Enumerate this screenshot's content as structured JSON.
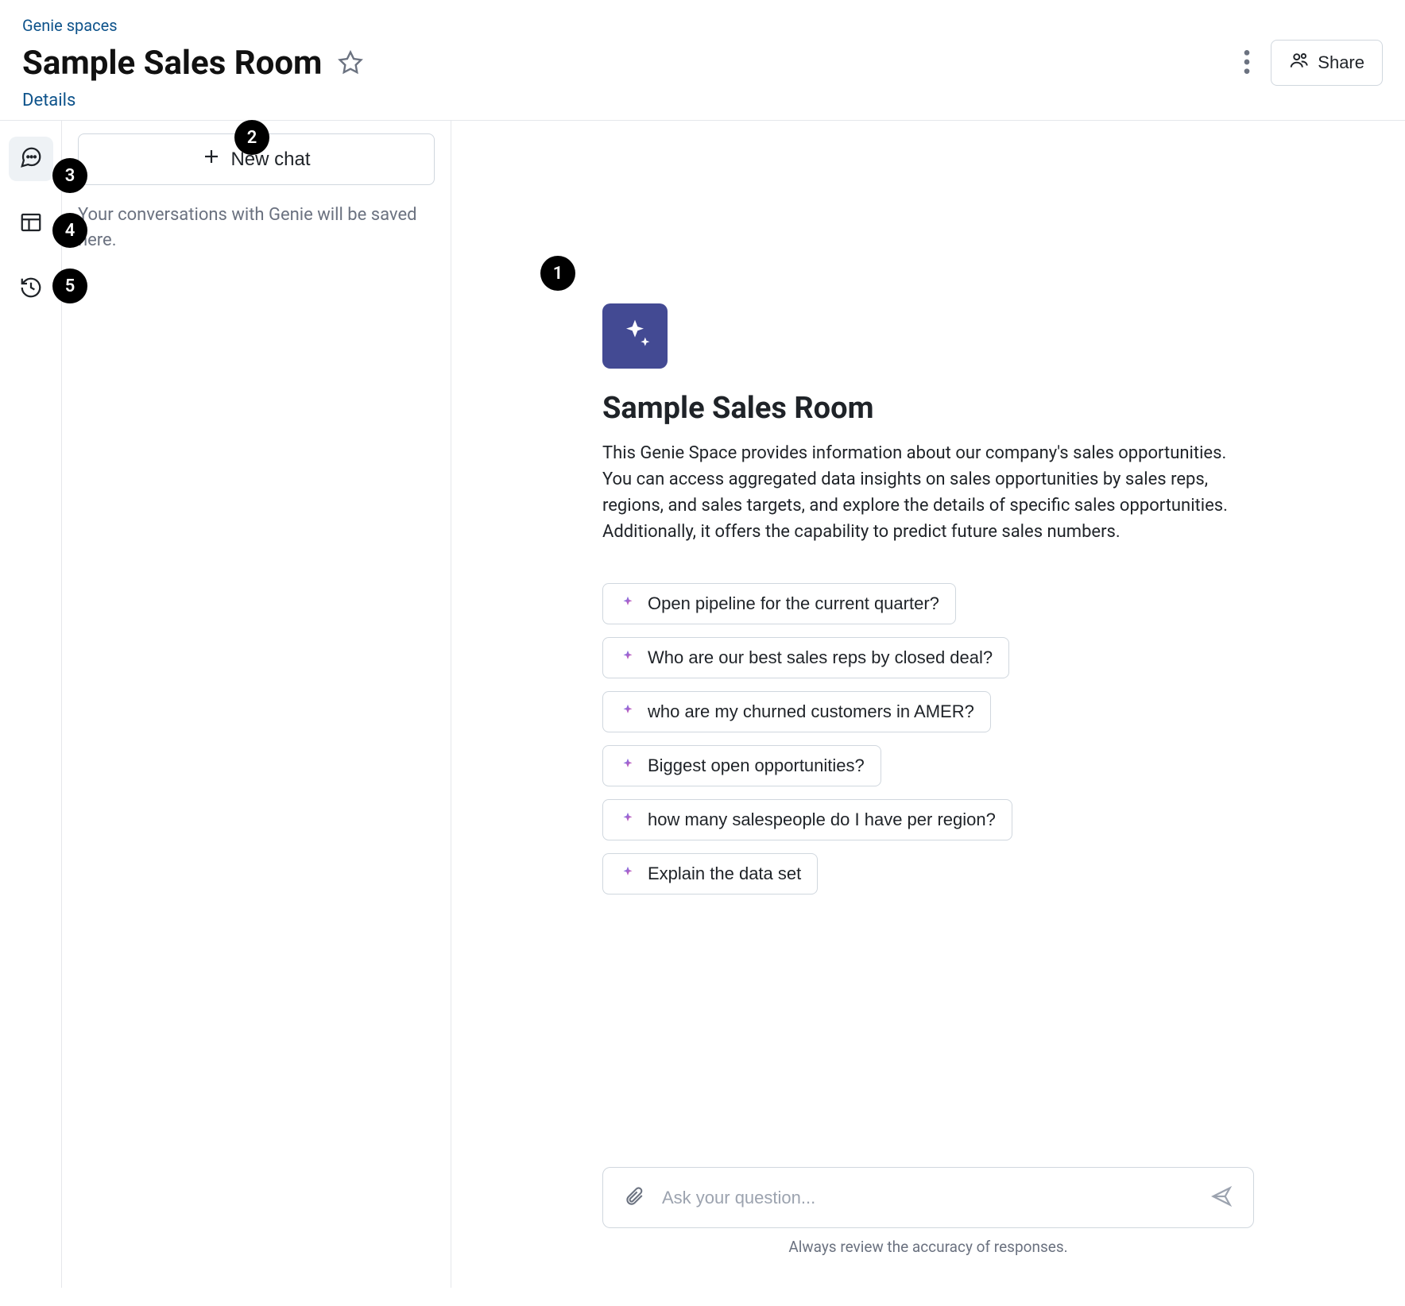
{
  "header": {
    "breadcrumb": "Genie spaces",
    "title": "Sample Sales Room",
    "details_link": "Details",
    "share_label": "Share"
  },
  "sidebar": {
    "new_chat_label": "New chat",
    "empty_text": "Your conversations with Genie will be saved here."
  },
  "main": {
    "title": "Sample Sales Room",
    "description": "This Genie Space provides information about our company's sales opportunities. You can access aggregated data insights on sales opportunities by sales reps, regions, and sales targets, and explore the details of specific sales opportunities. Additionally, it offers the capability to predict future sales numbers.",
    "suggestions": [
      "Open pipeline for the current quarter?",
      "Who are our best sales reps by closed deal?",
      "who are my churned customers in AMER?",
      "Biggest open opportunities?",
      "how many salespeople do I have per region?",
      "Explain the data set"
    ],
    "input_placeholder": "Ask your question...",
    "disclaimer": "Always review the accuracy of responses."
  },
  "callouts": {
    "c1": "1",
    "c2": "2",
    "c3": "3",
    "c4": "4",
    "c5": "5"
  }
}
